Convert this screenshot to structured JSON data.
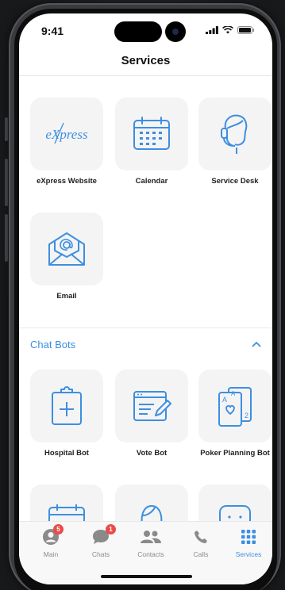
{
  "status_bar": {
    "time": "9:41"
  },
  "header": {
    "title": "Services"
  },
  "services": [
    {
      "label": "eXpress Website",
      "icon": "express-logo-icon",
      "logo_text": "eXpress"
    },
    {
      "label": "Calendar",
      "icon": "calendar-icon"
    },
    {
      "label": "Service Desk",
      "icon": "service-desk-icon"
    },
    {
      "label": "Email",
      "icon": "email-icon"
    }
  ],
  "chat_bots": {
    "title": "Chat Bots",
    "expanded": true,
    "items": [
      {
        "label": "Hospital Bot",
        "icon": "clipboard-plus-icon"
      },
      {
        "label": "Vote Bot",
        "icon": "vote-form-icon"
      },
      {
        "label": "Poker Planning Bot",
        "icon": "playing-cards-icon"
      },
      {
        "label": "",
        "icon": "calendar-icon"
      },
      {
        "label": "",
        "icon": "face-icon"
      },
      {
        "label": "",
        "icon": "smile-icon"
      }
    ]
  },
  "tabbar": {
    "tabs": [
      {
        "label": "Main",
        "badge": "5",
        "icon": "avatar-icon"
      },
      {
        "label": "Chats",
        "badge": "1",
        "icon": "chat-bubble-icon"
      },
      {
        "label": "Contacts",
        "icon": "contacts-icon"
      },
      {
        "label": "Calls",
        "icon": "phone-icon"
      },
      {
        "label": "Services",
        "icon": "grid-icon",
        "active": true
      }
    ]
  },
  "colors": {
    "accent": "#3d8fe0",
    "badge": "#ea4b4b",
    "tile_bg": "#f4f4f5"
  }
}
